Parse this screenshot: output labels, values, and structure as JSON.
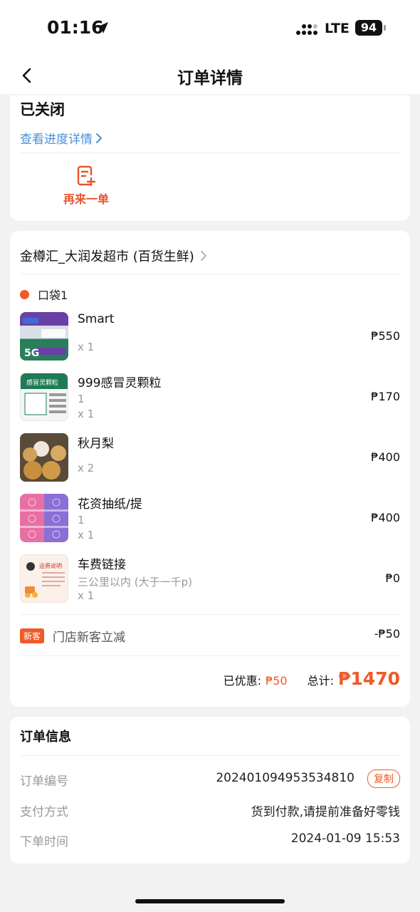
{
  "status_bar": {
    "time": "01:16",
    "network": "LTE",
    "battery": "94"
  },
  "nav": {
    "title": "订单详情"
  },
  "status": {
    "title": "已关闭",
    "progress_link": "查看进度详情",
    "reorder_label": "再来一单"
  },
  "order": {
    "store_name": "金樽汇_大润发超市 (百货生鲜)",
    "bag_label": "口袋1",
    "items": [
      {
        "name": "Smart",
        "spec": "",
        "qty": "x 1",
        "price": "₱550",
        "thumb_text": "5G"
      },
      {
        "name": "999感冒灵颗粒",
        "spec": "1",
        "qty": "x 1",
        "price": "₱170",
        "thumb_text": "感冒灵颗粒"
      },
      {
        "name": "秋月梨",
        "spec": "",
        "qty": "x 2",
        "price": "₱400",
        "thumb_text": ""
      },
      {
        "name": "花资抽纸/提",
        "spec": "1",
        "qty": "x 1",
        "price": "₱400",
        "thumb_text": ""
      },
      {
        "name": "车费链接",
        "spec": "三公里以内 (大于一千p)",
        "qty": "x 1",
        "price": "₱0",
        "thumb_text": "运费说明"
      }
    ],
    "promo": {
      "badge": "新客",
      "text": "门店新客立减",
      "amount": "-₱50"
    },
    "discount_label": "已优惠:",
    "discount_value": "₱50",
    "total_label": "总计:",
    "total_value": "₱1470"
  },
  "info": {
    "title": "订单信息",
    "rows": [
      {
        "label": "订单编号",
        "value": "202401094953534810",
        "action": "复制"
      },
      {
        "label": "支付方式",
        "value": "货到付款,请提前准备好零钱"
      },
      {
        "label": "下单时间",
        "value": "2024-01-09 15:53"
      }
    ]
  },
  "colors": {
    "accent": "#f05a28",
    "link": "#4a90d9"
  }
}
